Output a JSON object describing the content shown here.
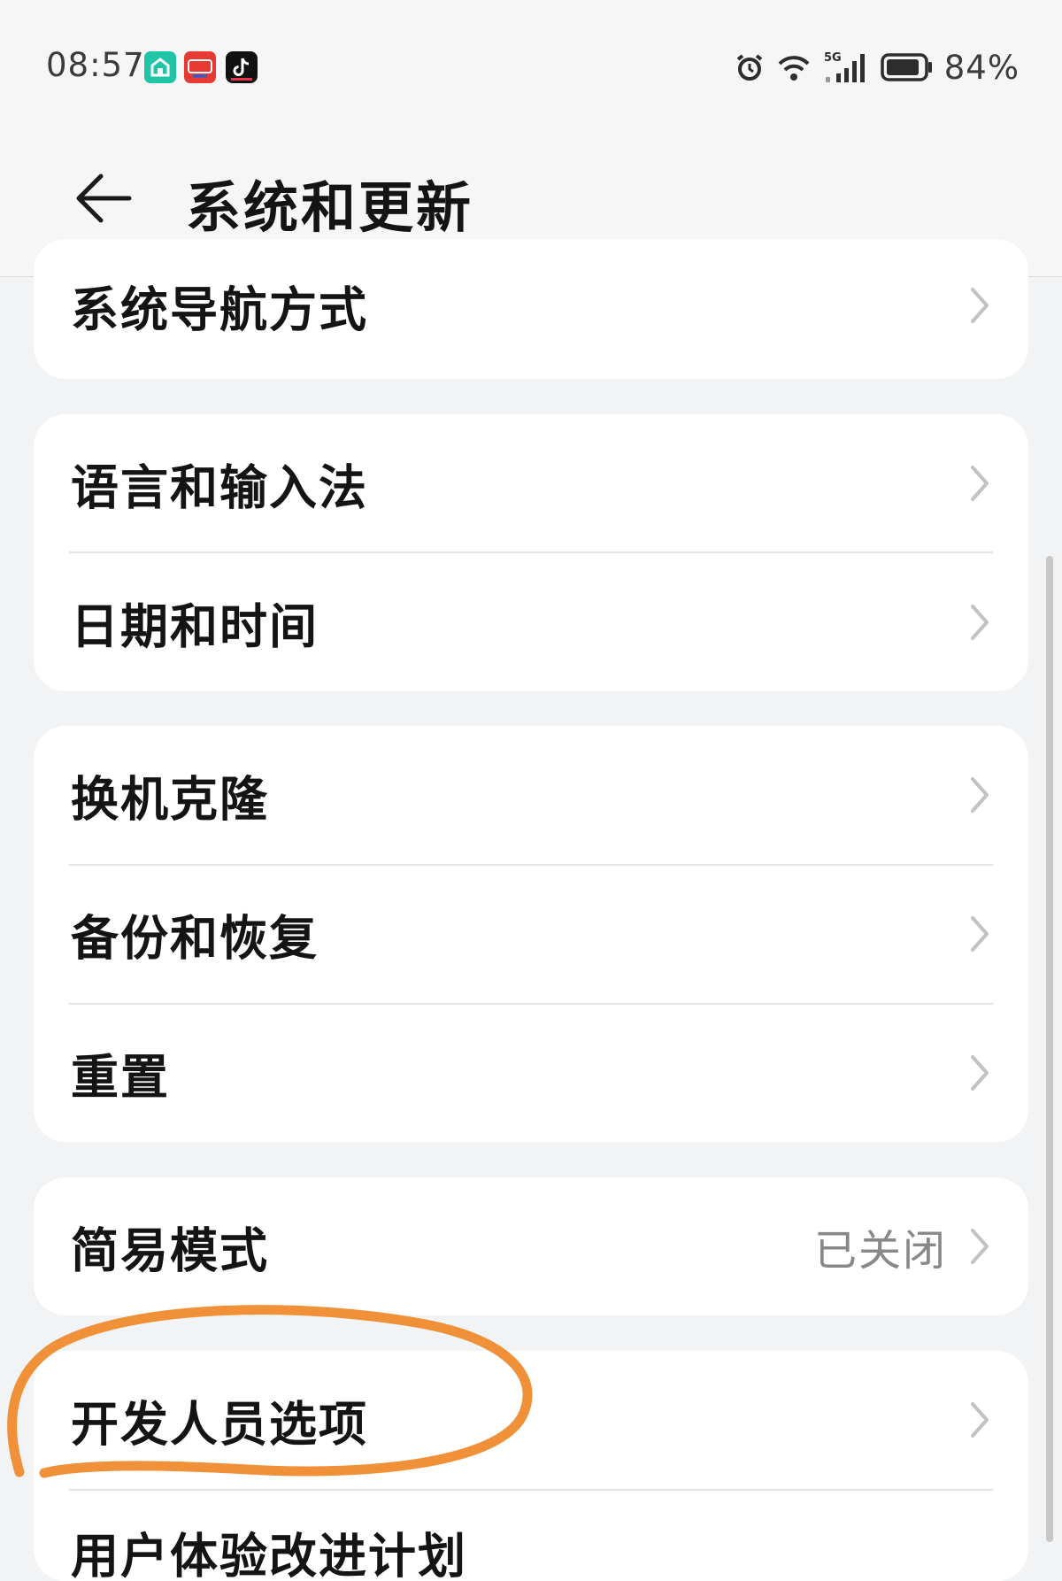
{
  "status_bar": {
    "time": "08:57",
    "battery_percent": "84%",
    "network_label": "5G",
    "notification_icons": [
      "smart-home-icon",
      "cloud-pay-icon",
      "tiktok-icon"
    ],
    "system_icons": [
      "alarm-icon",
      "wifi-icon",
      "signal-icon",
      "battery-icon"
    ]
  },
  "header": {
    "title": "系统和更新",
    "back_icon": "arrow-left-icon"
  },
  "groups": [
    {
      "items": [
        {
          "label": "系统导航方式",
          "value": ""
        }
      ]
    },
    {
      "items": [
        {
          "label": "语言和输入法",
          "value": ""
        },
        {
          "label": "日期和时间",
          "value": ""
        }
      ]
    },
    {
      "items": [
        {
          "label": "换机克隆",
          "value": ""
        },
        {
          "label": "备份和恢复",
          "value": ""
        },
        {
          "label": "重置",
          "value": ""
        }
      ]
    },
    {
      "items": [
        {
          "label": "简易模式",
          "value": "已关闭"
        }
      ]
    },
    {
      "items": [
        {
          "label": "开发人员选项",
          "value": ""
        },
        {
          "label": "用户体验改进计划",
          "value": ""
        }
      ]
    }
  ],
  "colors": {
    "background": "#f1f3f5",
    "card": "#ffffff",
    "annotation": "#f0913a",
    "secondary_text": "#888888"
  }
}
